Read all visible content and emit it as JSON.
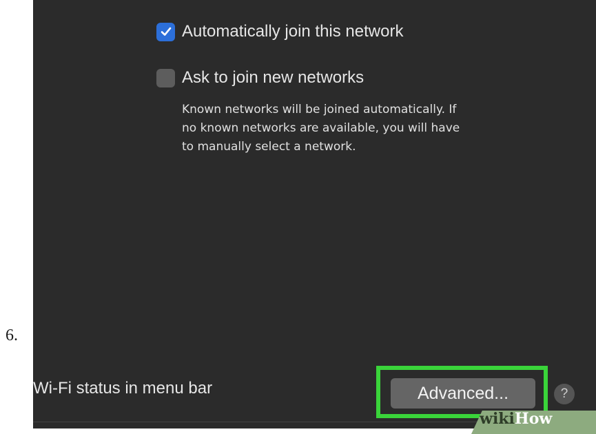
{
  "step": {
    "number": "6."
  },
  "options": [
    {
      "label": "Automatically join this network",
      "checked": true
    },
    {
      "label": "Ask to join new networks",
      "checked": false
    }
  ],
  "description": "Known networks will be joined automatically. If\nno known networks are available, you will have\nto manually select a network.",
  "status_label": "Wi-Fi status in menu bar",
  "buttons": {
    "advanced": "Advanced...",
    "help": "?"
  },
  "watermark": {
    "part1": "wiki",
    "part2": "How"
  },
  "colors": {
    "panel_bg": "#2b2b2b",
    "checkbox_checked": "#2c6fd9",
    "highlight": "#3ad43a"
  }
}
